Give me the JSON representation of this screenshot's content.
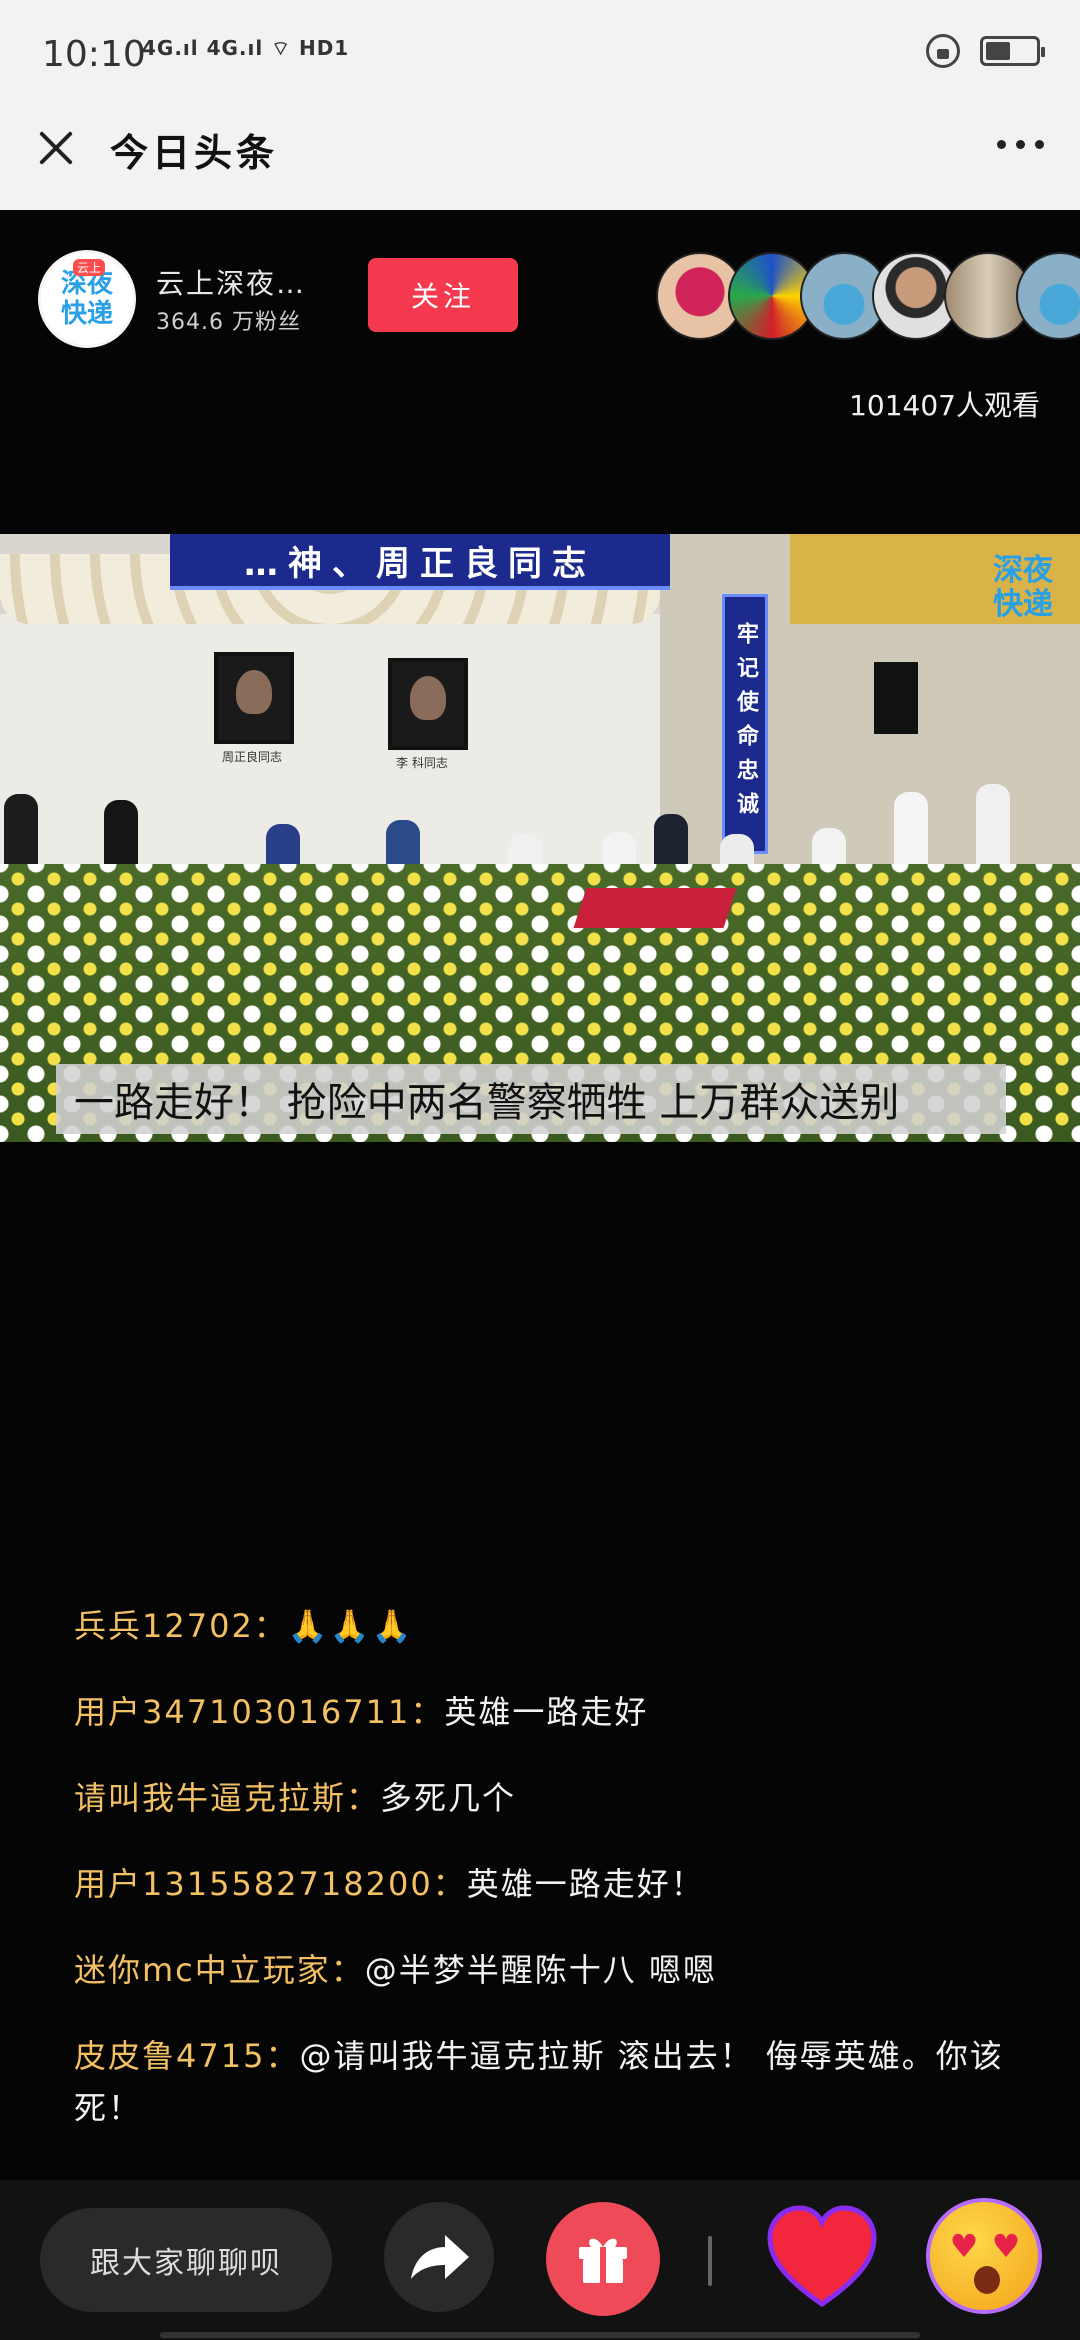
{
  "status_bar": {
    "time": "10:10",
    "network": "4G.ıl 4G.ıl ⌔ HD1",
    "battery_level": 0.45
  },
  "app_bar": {
    "title": "今日头条"
  },
  "live": {
    "host_name": "云上深夜…",
    "host_logo_line1": "深夜",
    "host_logo_line2": "快递",
    "host_logo_badge": "云上",
    "fans": "364.6 万粉丝",
    "follow_label": "关注",
    "viewer_count": "101407人观看"
  },
  "video": {
    "banner_top": "…神、周正良同志",
    "vertical_banner": "牢记使命忠诚",
    "portrait_left_caption": "周正良同志",
    "portrait_right_caption": "李 科同志",
    "watermark_line1": "深夜",
    "watermark_line2": "快递",
    "caption": "一路走好！ 抢险中两名警察牺牲  上万群众送别"
  },
  "comments": [
    {
      "user": "兵兵12702：",
      "text": "🙏🙏🙏"
    },
    {
      "user": "用户347103016711：",
      "text": "英雄一路走好"
    },
    {
      "user": "请叫我牛逼克拉斯：",
      "text": "多死几个"
    },
    {
      "user": "用户1315582718200：",
      "text": "英雄一路走好！"
    },
    {
      "user": "迷你mc中立玩家：",
      "text": "@半梦半醒陈十八 嗯嗯"
    },
    {
      "user": "皮皮鲁4715：",
      "text": "@请叫我牛逼克拉斯 滚出去！ 侮辱英雄。你该死！"
    }
  ],
  "bottom_bar": {
    "chat_placeholder": "跟大家聊聊呗"
  },
  "colors": {
    "follow": "#f5394e",
    "comment_user": "#f3c063",
    "gift": "#ee4a57"
  }
}
